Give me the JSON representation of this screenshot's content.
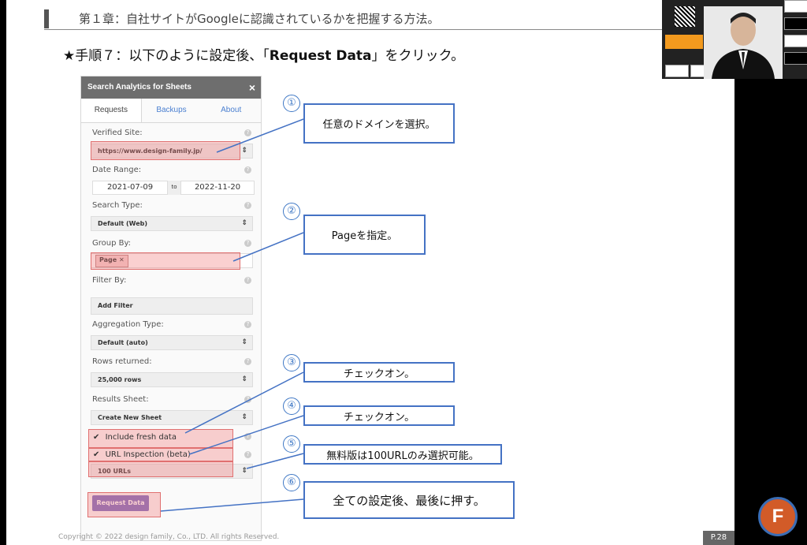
{
  "slide": {
    "chapter_title": "第１章：自社サイトがGoogleに認識されているかを把握する方法。",
    "step_prefix": "★手順７：以下のように設定後、「",
    "step_bold": "Request Data",
    "step_suffix": "」をクリック。",
    "footer": "Copyright © 2022 design family, Co., LTD. All rights Reserved.",
    "page_number": "P.28"
  },
  "panel": {
    "title": "Search Analytics for Sheets",
    "close": "×",
    "tabs": [
      "Requests",
      "Backups",
      "About"
    ],
    "verified_site_label": "Verified Site:",
    "verified_site_value": "https://www.design-family.jp/",
    "date_range_label": "Date Range:",
    "date_from": "2021-07-09",
    "date_to_sep": "to",
    "date_to": "2022-11-20",
    "search_type_label": "Search Type:",
    "search_type_value": "Default (Web)",
    "group_by_label": "Group By:",
    "group_by_tag": "Page",
    "filter_by_label": "Filter By:",
    "add_filter": "Add Filter",
    "aggregation_label": "Aggregation Type:",
    "aggregation_value": "Default (auto)",
    "rows_label": "Rows returned:",
    "rows_value": "25,000 rows",
    "results_label": "Results Sheet:",
    "results_value": "Create New Sheet",
    "fresh_data": "Include fresh data",
    "url_inspection": "URL Inspection (beta)",
    "url_count": "100 URLs",
    "request_button": "Request Data"
  },
  "callouts": {
    "c1": {
      "num": "①",
      "text": "任意のドメインを選択。"
    },
    "c2": {
      "num": "②",
      "text": "Pageを指定。"
    },
    "c3": {
      "num": "③",
      "text": "チェックオン。"
    },
    "c4": {
      "num": "④",
      "text": "チェックオン。"
    },
    "c5": {
      "num": "⑤",
      "text": "無料版は100URLのみ選択可能。"
    },
    "c6": {
      "num": "⑥",
      "text": "全ての設定後、最後に押す。"
    }
  },
  "brand": {
    "logo_letter": "F"
  },
  "colors": {
    "callout_border": "#4472c4",
    "highlight": "#f07878",
    "button": "#7b6dc2"
  }
}
